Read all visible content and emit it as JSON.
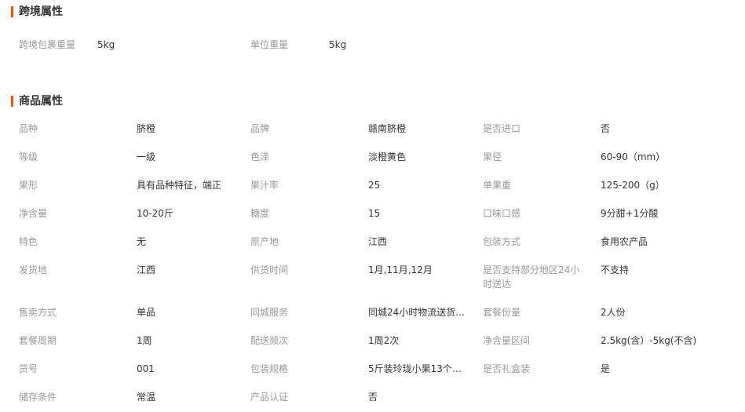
{
  "cross_border": {
    "title": "跨境属性",
    "items": [
      {
        "label": "跨境包裹重量",
        "value": "5kg"
      },
      {
        "label": "单位重量",
        "value": "5kg"
      }
    ]
  },
  "product": {
    "title": "商品属性",
    "rows": [
      [
        {
          "label": "品种",
          "value": "脐橙"
        },
        {
          "label": "品牌",
          "value": "赣南脐橙"
        },
        {
          "label": "是否进口",
          "value": "否"
        }
      ],
      [
        {
          "label": "等级",
          "value": "一级"
        },
        {
          "label": "色泽",
          "value": "淡橙黄色"
        },
        {
          "label": "果径",
          "value": "60-90（mm）"
        }
      ],
      [
        {
          "label": "果形",
          "value": "具有品种特征，端正"
        },
        {
          "label": "果汁率",
          "value": "25"
        },
        {
          "label": "单果重",
          "value": "125-200（g）"
        }
      ],
      [
        {
          "label": "净含量",
          "value": "10-20斤"
        },
        {
          "label": "糖度",
          "value": "15"
        },
        {
          "label": "口味口感",
          "value": "9分甜+1分酸"
        }
      ],
      [
        {
          "label": "特色",
          "value": "无"
        },
        {
          "label": "原产地",
          "value": "江西"
        },
        {
          "label": "包装方式",
          "value": "食用农产品"
        }
      ],
      [
        {
          "label": "发货地",
          "value": "江西"
        },
        {
          "label": "供货时间",
          "value": "1月,11月,12月"
        },
        {
          "label": "是否支持部分地区24小时送达",
          "value": "不支持"
        }
      ],
      [
        {
          "label": "售卖方式",
          "value": "单品"
        },
        {
          "label": "同城服务",
          "value": "同城24小时物流送货..."
        },
        {
          "label": "套餐份量",
          "value": "2人份"
        }
      ],
      [
        {
          "label": "套餐周期",
          "value": "1周"
        },
        {
          "label": "配送频次",
          "value": "1周2次"
        },
        {
          "label": "净含量区间",
          "value": "2.5kg(含）-5kg(不含)"
        }
      ],
      [
        {
          "label": "货号",
          "value": "001"
        },
        {
          "label": "包装规格",
          "value": "5斤装玲珑小果13个左..."
        },
        {
          "label": "是否礼盒装",
          "value": "是"
        }
      ],
      [
        {
          "label": "储存条件",
          "value": "常温"
        },
        {
          "label": "产品认证",
          "value": "否"
        },
        {
          "label": "",
          "value": ""
        }
      ]
    ]
  }
}
